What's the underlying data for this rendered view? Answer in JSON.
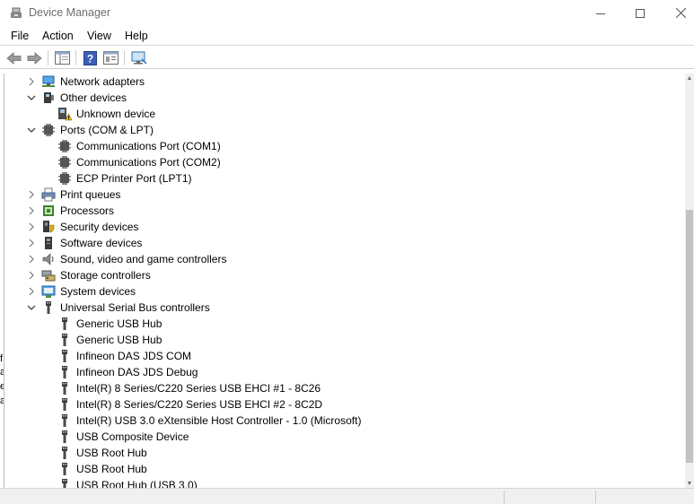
{
  "window": {
    "title": "Device Manager"
  },
  "menu": {
    "file": "File",
    "action": "Action",
    "view": "View",
    "help": "Help"
  },
  "toolbar": {
    "buttons": [
      {
        "icon": "back-arrow-icon"
      },
      {
        "icon": "forward-arrow-icon"
      },
      {
        "icon": "show-hide-console-tree-icon"
      },
      {
        "icon": "help-icon"
      },
      {
        "icon": "properties-icon"
      },
      {
        "icon": "monitor-icon"
      }
    ]
  },
  "tree": {
    "rows": [
      {
        "label": "Network adapters",
        "level": 0,
        "expander": "collapsed",
        "icon": "network-adapter-icon"
      },
      {
        "label": "Other devices",
        "level": 0,
        "expander": "expanded",
        "icon": "other-devices-icon"
      },
      {
        "label": "Unknown device",
        "level": 1,
        "expander": "none",
        "icon": "unknown-device-warning-icon"
      },
      {
        "label": "Ports (COM & LPT)",
        "level": 0,
        "expander": "expanded",
        "icon": "port-icon"
      },
      {
        "label": "Communications Port (COM1)",
        "level": 1,
        "expander": "none",
        "icon": "port-icon"
      },
      {
        "label": "Communications Port (COM2)",
        "level": 1,
        "expander": "none",
        "icon": "port-icon"
      },
      {
        "label": "ECP Printer Port (LPT1)",
        "level": 1,
        "expander": "none",
        "icon": "port-icon"
      },
      {
        "label": "Print queues",
        "level": 0,
        "expander": "collapsed",
        "icon": "printer-icon"
      },
      {
        "label": "Processors",
        "level": 0,
        "expander": "collapsed",
        "icon": "processor-icon"
      },
      {
        "label": "Security devices",
        "level": 0,
        "expander": "collapsed",
        "icon": "security-device-icon"
      },
      {
        "label": "Software devices",
        "level": 0,
        "expander": "collapsed",
        "icon": "software-device-icon"
      },
      {
        "label": "Sound, video and game controllers",
        "level": 0,
        "expander": "collapsed",
        "icon": "speaker-icon"
      },
      {
        "label": "Storage controllers",
        "level": 0,
        "expander": "collapsed",
        "icon": "storage-controller-icon"
      },
      {
        "label": "System devices",
        "level": 0,
        "expander": "collapsed",
        "icon": "system-device-icon"
      },
      {
        "label": "Universal Serial Bus controllers",
        "level": 0,
        "expander": "expanded",
        "icon": "usb-icon"
      },
      {
        "label": "Generic USB Hub",
        "level": 1,
        "expander": "none",
        "icon": "usb-icon"
      },
      {
        "label": "Generic USB Hub",
        "level": 1,
        "expander": "none",
        "icon": "usb-icon"
      },
      {
        "label": "Infineon DAS JDS COM",
        "level": 1,
        "expander": "none",
        "icon": "usb-icon"
      },
      {
        "label": "Infineon DAS JDS Debug",
        "level": 1,
        "expander": "none",
        "icon": "usb-icon"
      },
      {
        "label": "Intel(R) 8 Series/C220 Series USB EHCI #1 - 8C26",
        "level": 1,
        "expander": "none",
        "icon": "usb-icon"
      },
      {
        "label": "Intel(R) 8 Series/C220 Series USB EHCI #2 - 8C2D",
        "level": 1,
        "expander": "none",
        "icon": "usb-icon"
      },
      {
        "label": "Intel(R) USB 3.0 eXtensible Host Controller - 1.0 (Microsoft)",
        "level": 1,
        "expander": "none",
        "icon": "usb-icon"
      },
      {
        "label": "USB Composite Device",
        "level": 1,
        "expander": "none",
        "icon": "usb-icon"
      },
      {
        "label": "USB Root Hub",
        "level": 1,
        "expander": "none",
        "icon": "usb-icon"
      },
      {
        "label": "USB Root Hub",
        "level": 1,
        "expander": "none",
        "icon": "usb-icon"
      },
      {
        "label": "USB Root Hub (USB 3.0)",
        "level": 1,
        "expander": "none",
        "icon": "usb-icon"
      }
    ]
  },
  "left_cut_glyphs": [
    "f",
    "a",
    "e",
    "a"
  ]
}
